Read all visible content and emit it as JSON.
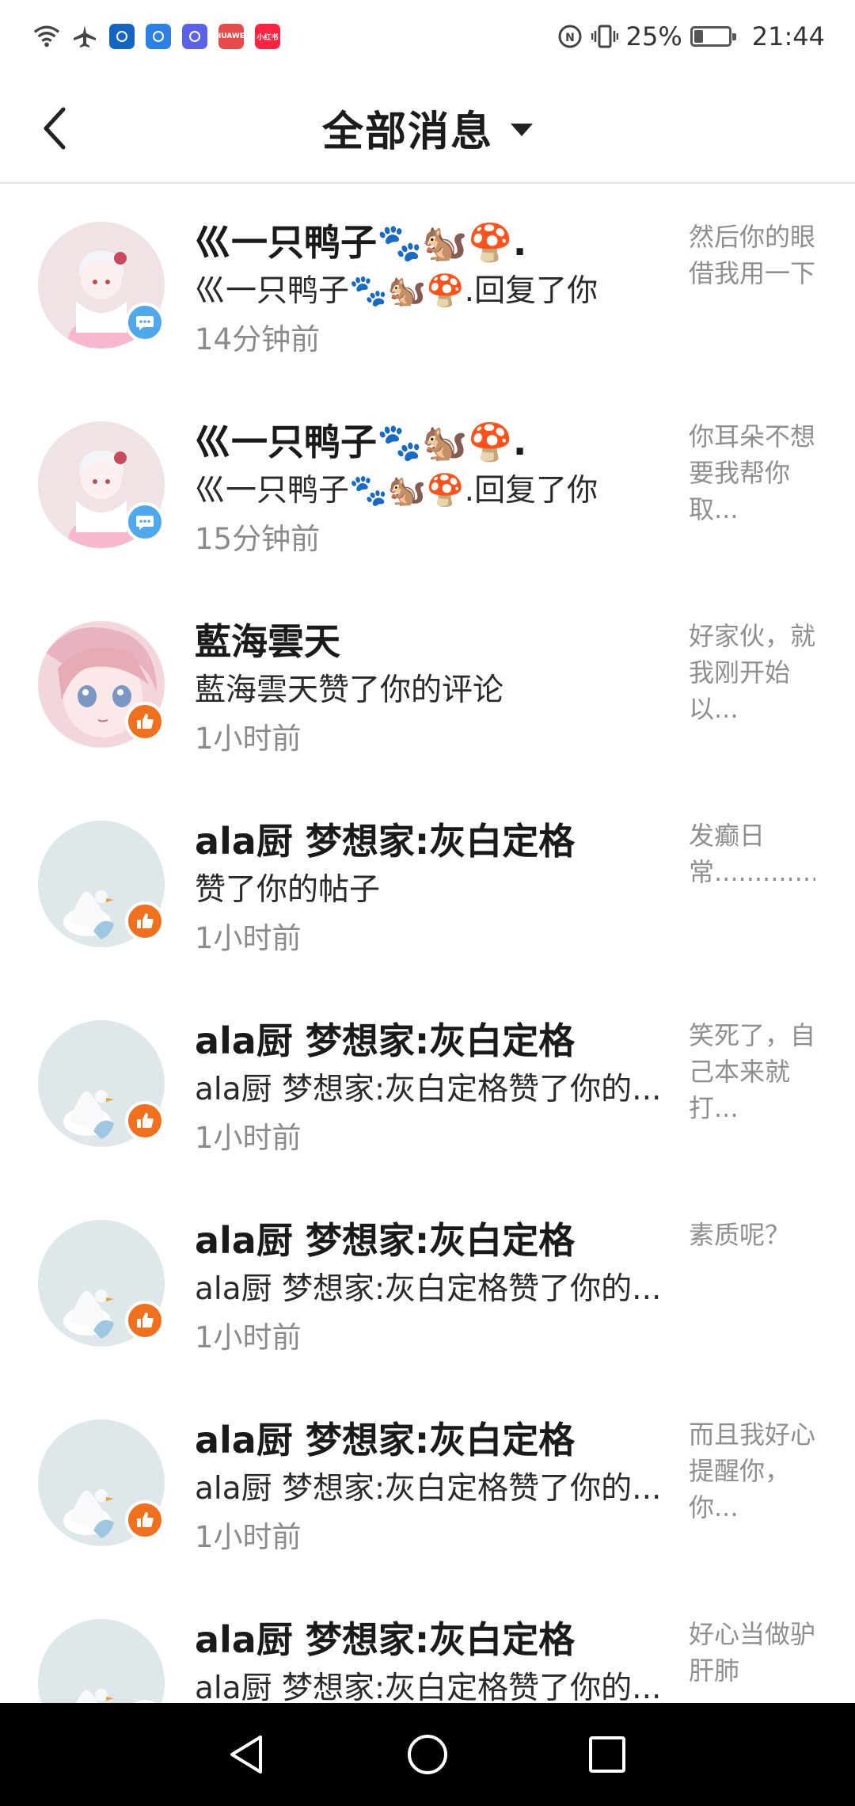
{
  "status_bar": {
    "battery_text": "25%",
    "battery_level": 0.25,
    "time": "21:44",
    "apps": [
      {
        "icon": "shield-app-icon",
        "color": "#1565c0",
        "label": ""
      },
      {
        "icon": "browser-app-icon",
        "color": "#2b80e3",
        "label": ""
      },
      {
        "icon": "music-app-icon",
        "color": "#5a63e8",
        "label": ""
      },
      {
        "icon": "huawei-app-icon",
        "color": "#e84a4a",
        "label": "HUAWEI"
      },
      {
        "icon": "xiaohongshu-app-icon",
        "color": "#ff2442",
        "label": "小红书"
      }
    ]
  },
  "header": {
    "title": "全部消息"
  },
  "messages": [
    {
      "name": "巛一只鸭子🐾🐿️🍄.",
      "desc": "巛一只鸭子🐾🐿️🍄.回复了你",
      "time": "14分钟前",
      "preview": "然后你的眼借我用一下",
      "type": "reply",
      "avatar": "anime-girl-white"
    },
    {
      "name": "巛一只鸭子🐾🐿️🍄.",
      "desc": "巛一只鸭子🐾🐿️🍄.回复了你",
      "time": "15分钟前",
      "preview": "你耳朵不想要我帮你取...",
      "type": "reply",
      "avatar": "anime-girl-white"
    },
    {
      "name": "藍海雲天",
      "desc": "藍海雲天赞了你的评论",
      "time": "1小时前",
      "preview": "好家伙，就我刚开始以...",
      "type": "like",
      "avatar": "anime-girl-pink"
    },
    {
      "name": "ala厨 梦想家:灰白定格",
      "desc": "赞了你的帖子",
      "time": "1小时前",
      "preview": "发癫日常.....................",
      "type": "like",
      "avatar": "white-duck"
    },
    {
      "name": "ala厨 梦想家:灰白定格",
      "desc": "ala厨 梦想家:灰白定格赞了你的...",
      "time": "1小时前",
      "preview": "笑死了，自己本来就打...",
      "type": "like",
      "avatar": "white-duck"
    },
    {
      "name": "ala厨 梦想家:灰白定格",
      "desc": "ala厨 梦想家:灰白定格赞了你的...",
      "time": "1小时前",
      "preview": "素质呢？",
      "type": "like",
      "avatar": "white-duck"
    },
    {
      "name": "ala厨 梦想家:灰白定格",
      "desc": "ala厨 梦想家:灰白定格赞了你的...",
      "time": "1小时前",
      "preview": "而且我好心提醒你，你...",
      "type": "like",
      "avatar": "white-duck"
    },
    {
      "name": "ala厨 梦想家:灰白定格",
      "desc": "ala厨 梦想家:灰白定格赞了你的...",
      "time": "",
      "preview": "好心当做驴肝肺",
      "type": "like",
      "avatar": "white-duck"
    }
  ],
  "nav": {
    "buttons": [
      "back-triangle-icon",
      "home-circle-icon",
      "recents-square-icon"
    ]
  },
  "colors": {
    "reply_badge": "#4fa8ec",
    "like_badge": "#f0701e"
  }
}
